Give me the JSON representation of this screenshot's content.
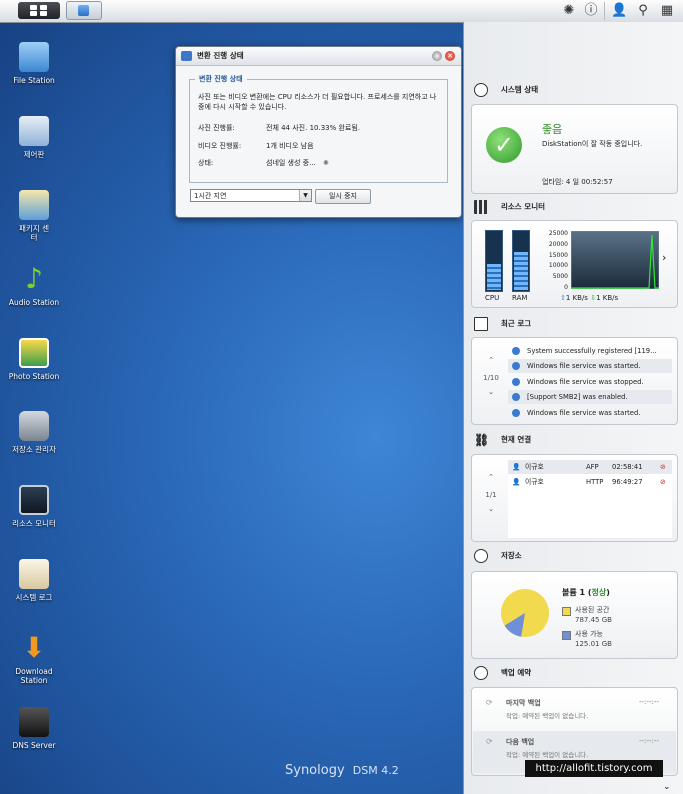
{
  "desktop": {
    "icons": [
      {
        "label": "File Station",
        "icon": "file-station-icon"
      },
      {
        "label": "제어판",
        "icon": "control-panel-icon"
      },
      {
        "label": "패키지 센터",
        "icon": "package-center-icon"
      },
      {
        "label": "Audio Station",
        "icon": "audio-station-icon"
      },
      {
        "label": "Photo Station",
        "icon": "photo-station-icon"
      },
      {
        "label": "저장소 관리자",
        "icon": "storage-manager-icon"
      },
      {
        "label": "리소스 모니터",
        "icon": "resource-monitor-icon"
      },
      {
        "label": "시스템 로그",
        "icon": "system-log-icon"
      },
      {
        "label": "Download Station",
        "icon": "download-station-icon"
      },
      {
        "label": "DNS Server",
        "icon": "dns-server-icon"
      }
    ],
    "brand": "Synology",
    "version": "DSM 4.2",
    "watermark": "http://allofit.tistory.com"
  },
  "window": {
    "title": "변환 진행 상태",
    "group_title": "변환 진행 상태",
    "description": "사진 또는 비디오 변환에는 CPU 리소스가 더 필요합니다. 프로세스를 지연하고 나중에 다시 시작할 수 있습니다.",
    "photo_label": "사진 진행률:",
    "photo_value": "전체 44 사진. 10.33% 완료됨.",
    "video_label": "비디오 진행률:",
    "video_value": "1개 비디오 남음",
    "status_label": "상태:",
    "status_value": "섬네일 생성 중...",
    "delay_select": "1시간 지연",
    "pause_button": "일시 중지"
  },
  "widgets": {
    "system": {
      "title": "시스템 상태",
      "status": "좋음",
      "message": "DiskStation이 잘 작동 중입니다.",
      "uptime": "업타임: 4 일 00:52:57"
    },
    "resource": {
      "title": "리소스 모니터",
      "cpu_label": "CPU",
      "ram_label": "RAM",
      "cpu_level": 0.45,
      "ram_level": 0.65,
      "y_ticks": [
        "25000",
        "20000",
        "15000",
        "10000",
        "5000",
        "0"
      ],
      "up_rate": "1 KB/s",
      "down_rate": "1 KB/s"
    },
    "logs": {
      "title": "최근 로그",
      "pager": "1/10",
      "items": [
        "System successfully registered [119...",
        "Windows file service was started.",
        "Windows file service was stopped.",
        "[Support SMB2] was enabled.",
        "Windows file service was started."
      ]
    },
    "connections": {
      "title": "현재 연결",
      "pager": "1/1",
      "rows": [
        {
          "user": "이규호",
          "proto": "AFP",
          "time": "02:58:41"
        },
        {
          "user": "이규호",
          "proto": "HTTP",
          "time": "96:49:27"
        }
      ]
    },
    "storage": {
      "title": "저장소",
      "volume": "볼륨 1",
      "volume_status": "정상",
      "used_label": "사용된 공간",
      "used_value": "787.45 GB",
      "free_label": "사용 가능",
      "free_value": "125.01 GB",
      "used_color": "#f2da4e",
      "free_color": "#6f8fd6"
    },
    "backup": {
      "title": "백업 예약",
      "last_label": "마지막 백업",
      "last_detail": "작업: 예약된 백업이 없습니다.",
      "last_time": "--:--:--",
      "next_label": "다음 백업",
      "next_detail": "작업: 예약된 백업이 없습니다.",
      "next_time": "--:--:--"
    }
  }
}
